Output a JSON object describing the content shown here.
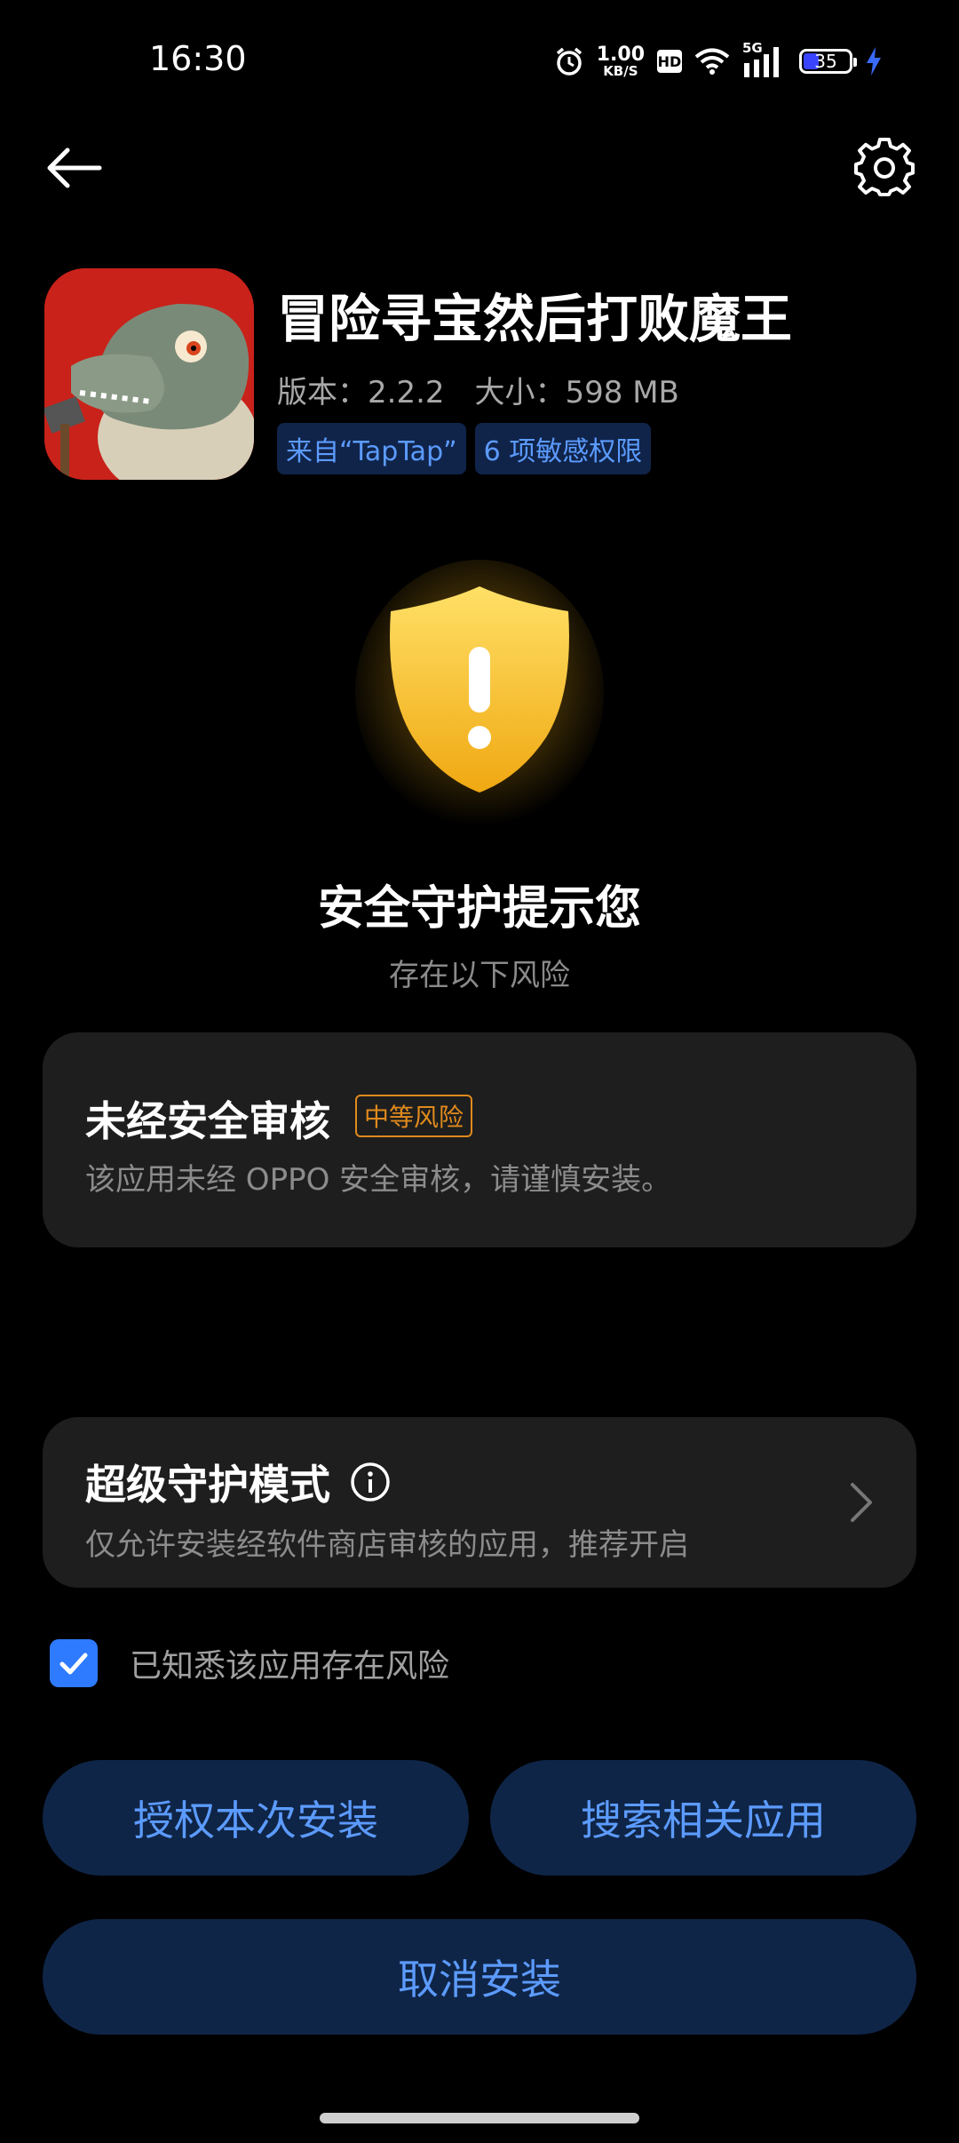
{
  "status_bar": {
    "time": "16:30",
    "net_speed_value": "1.00",
    "net_speed_unit": "KB/S",
    "hd_label": "HD",
    "network_type": "5G",
    "battery_level": "35"
  },
  "nav": {
    "back_icon": "arrow-left-icon",
    "settings_icon": "gear-icon"
  },
  "app": {
    "name": "冒险寻宝然后打败魔王",
    "version": "版本：2.2.2",
    "size": "大小：598 MB",
    "tags": [
      "来自“TapTap”",
      "6 项敏感权限"
    ]
  },
  "alert": {
    "icon": "warning-shield-icon",
    "title": "安全守护提示您",
    "subtitle": "存在以下风险"
  },
  "risk": {
    "title": "未经安全审核",
    "badge": "中等风险",
    "description": "该应用未经 OPPO 安全审核，请谨慎安装。"
  },
  "guard": {
    "title": "超级守护模式",
    "description": "仅允许安装经软件商店审核的应用，推荐开启"
  },
  "ack": {
    "label": "已知悉该应用存在风险",
    "checked": true
  },
  "buttons": {
    "authorize": "授权本次安装",
    "search": "搜索相关应用",
    "cancel": "取消安装"
  },
  "colors": {
    "accent": "#5c9bff",
    "button_bg": "#0f2547",
    "warning": "#e08a1c",
    "shield": "#f5c518"
  }
}
